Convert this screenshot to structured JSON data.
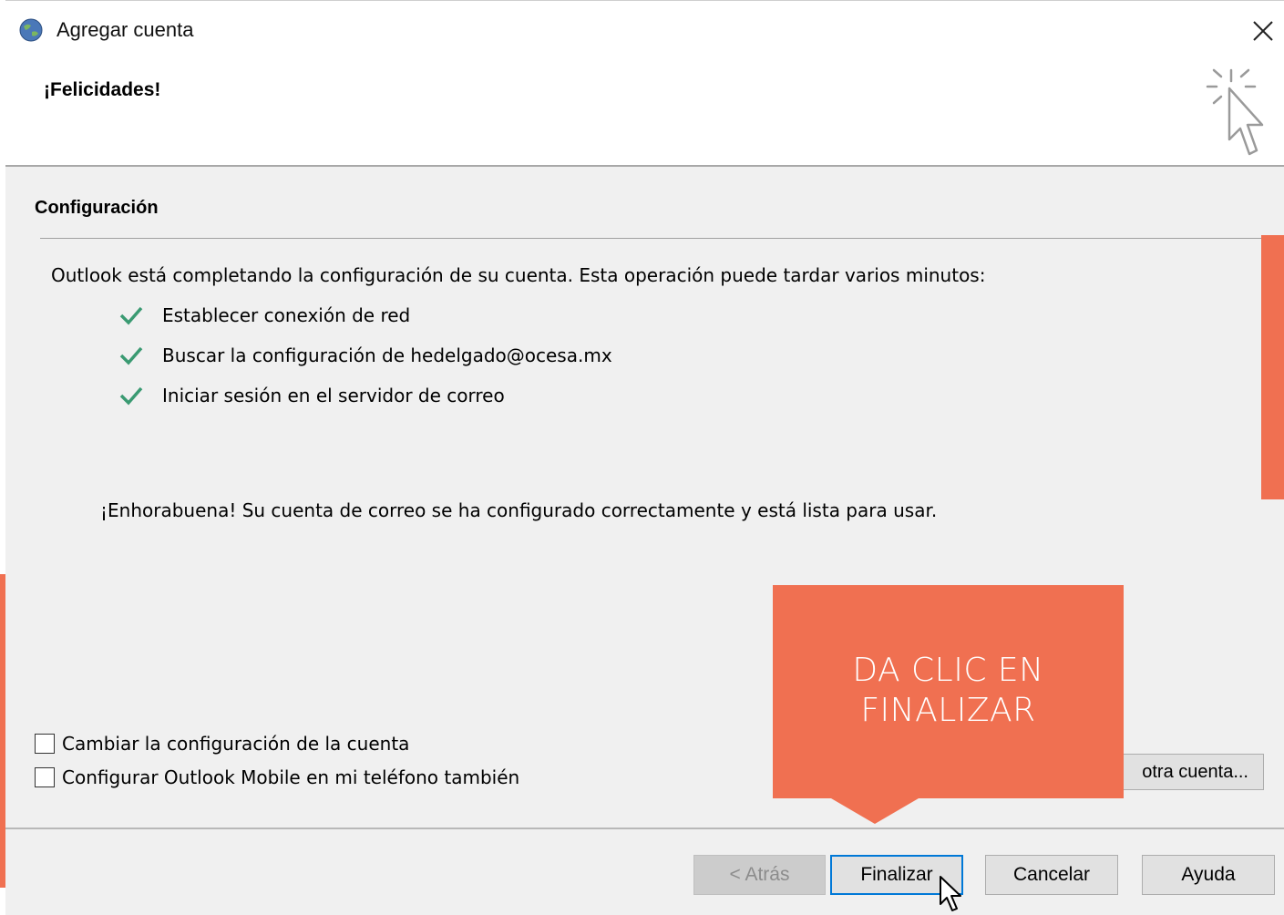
{
  "window": {
    "title": "Agregar cuenta"
  },
  "header": {
    "title": "¡Felicidades!"
  },
  "section": {
    "title": "Configuración",
    "intro": "Outlook está completando la configuración de su cuenta. Esta operación puede tardar varios minutos:",
    "steps": [
      {
        "label": "Establecer conexión de red",
        "status": "done"
      },
      {
        "label": "Buscar la configuración de hedelgado@ocesa.mx",
        "status": "done"
      },
      {
        "label": "Iniciar sesión en el servidor de correo",
        "status": "done"
      }
    ],
    "success_message": "¡Enhorabuena! Su cuenta de correo se ha configurado correctamente y está lista para usar."
  },
  "options": {
    "change_settings": {
      "label": "Cambiar la configuración de la cuenta",
      "checked": false
    },
    "mobile_setup": {
      "label": "Configurar Outlook Mobile en mi teléfono también",
      "checked": false
    },
    "other_account_label": "otra cuenta..."
  },
  "buttons": {
    "back": "< Atrás",
    "finish": "Finalizar",
    "cancel": "Cancelar",
    "help": "Ayuda"
  },
  "callout": {
    "text_line1": "DA CLIC EN",
    "text_line2": "FINALIZAR"
  },
  "colors": {
    "accent": "#f07051",
    "check": "#3a9a72",
    "focus": "#0078d7"
  },
  "icons": {
    "app": "outlook-globe-icon",
    "close": "close-icon",
    "wizard": "wizard-click-icon",
    "check": "checkmark-icon",
    "cursor": "mouse-pointer-icon"
  }
}
